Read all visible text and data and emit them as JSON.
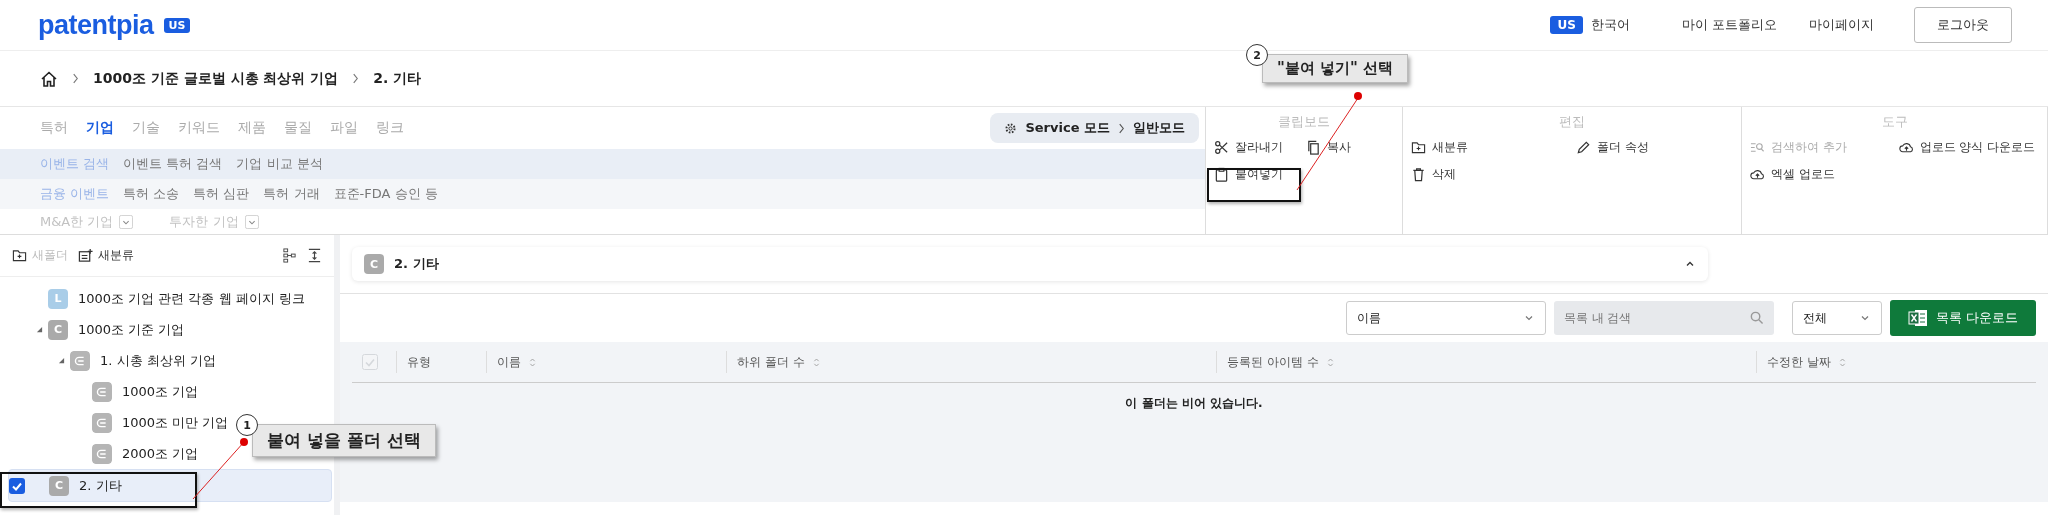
{
  "header": {
    "logo": "patentpia",
    "region_badge": "US",
    "language_badge": "US",
    "language": "한국어",
    "links": [
      "마이 포트폴리오",
      "마이페이지"
    ],
    "logout": "로그아웃"
  },
  "breadcrumb": [
    "1000조 기준 글로벌 시총 최상위 기업",
    "2. 기타"
  ],
  "menu": {
    "tabs": [
      {
        "label": "특허",
        "selected": false
      },
      {
        "label": "기업",
        "selected": true
      },
      {
        "label": "기술",
        "selected": false
      },
      {
        "label": "키워드",
        "selected": false
      },
      {
        "label": "제품",
        "selected": false
      },
      {
        "label": "물질",
        "selected": false
      },
      {
        "label": "파일",
        "selected": false
      },
      {
        "label": "링크",
        "selected": false
      }
    ],
    "rows": [
      [
        {
          "label": "이벤트 검색",
          "selected": true
        },
        {
          "label": "이벤트 특허 검색",
          "selected": false
        },
        {
          "label": "기업 비교 분석",
          "selected": false
        }
      ],
      [
        {
          "label": "금융 이벤트",
          "selected": true
        },
        {
          "label": "특허 소송",
          "selected": false
        },
        {
          "label": "특허 심판",
          "selected": false
        },
        {
          "label": "특허 거래",
          "selected": false
        },
        {
          "label": "표준-FDA 승인 등",
          "selected": false
        }
      ]
    ],
    "dropdowns": [
      {
        "label": "M&A한 기업",
        "disabled": true
      },
      {
        "label": "투자한 기업",
        "disabled": true
      }
    ],
    "mode": {
      "from": "Service 모드",
      "to": "일반모드"
    }
  },
  "toolbar": [
    {
      "title": "클립보드",
      "items": [
        {
          "label": "잘라내기",
          "disabled": false
        },
        {
          "label": "복사",
          "disabled": false
        },
        {
          "label": "붙여넣기",
          "disabled": false
        }
      ]
    },
    {
      "title": "편집",
      "items": [
        {
          "label": "새분류",
          "disabled": false
        },
        {
          "label": "폴더 속성",
          "disabled": false
        },
        {
          "label": "삭제",
          "disabled": false
        }
      ]
    },
    {
      "title": "도구",
      "items": [
        {
          "label": "검색하여 추가",
          "disabled": true
        },
        {
          "label": "업로드 양식 다운로드",
          "disabled": false
        },
        {
          "label": "엑셀 업로드",
          "disabled": false
        }
      ]
    }
  ],
  "sidebar": {
    "actions": [
      {
        "label": "새폴더",
        "disabled": true
      },
      {
        "label": "새분류",
        "disabled": false
      }
    ],
    "tree": [
      {
        "kind": "link",
        "badge": "L",
        "label": "1000조 기업 관련 각종 웹 페이지 링크",
        "selected": false,
        "checked": false
      },
      {
        "kind": "category",
        "badge": "C",
        "label": "1000조 기준 기업",
        "selected": false,
        "checked": false,
        "expanded": true,
        "children": [
          {
            "kind": "folder",
            "label": "1. 시총 최상위 기업",
            "selected": false,
            "checked": false,
            "expanded": true,
            "children": [
              {
                "kind": "folder",
                "label": "1000조 기업",
                "selected": false,
                "checked": false
              },
              {
                "kind": "folder",
                "label": "1000조 미만 기업",
                "selected": false,
                "checked": false
              },
              {
                "kind": "folder",
                "label": "2000조 기업",
                "selected": false,
                "checked": false
              }
            ]
          }
        ]
      },
      {
        "kind": "category",
        "badge": "C",
        "label": "2. 기타",
        "selected": true,
        "checked": true
      }
    ]
  },
  "folder_header": {
    "badge": "C",
    "title": "2. 기타",
    "expanded": true
  },
  "list_toolbar": {
    "sort": "이름",
    "search": {
      "placeholder": "목록 내 검색"
    },
    "filter": "전체",
    "download": "목록 다운로드"
  },
  "table": {
    "all_checked": false,
    "columns": [
      {
        "label": "유형",
        "sortable": false
      },
      {
        "label": "이름",
        "sortable": true
      },
      {
        "label": "하위 폴더 수",
        "sortable": true
      },
      {
        "label": "등록된 아이템 수",
        "sortable": true
      },
      {
        "label": "수정한 날짜",
        "sortable": true
      }
    ],
    "empty": "이 폴더는 비어 있습니다."
  },
  "annotations": [
    {
      "number": "1",
      "text": "붙여 넣을 폴더 선택"
    },
    {
      "number": "2",
      "text": "\"붙여 넣기\" 선택"
    }
  ]
}
